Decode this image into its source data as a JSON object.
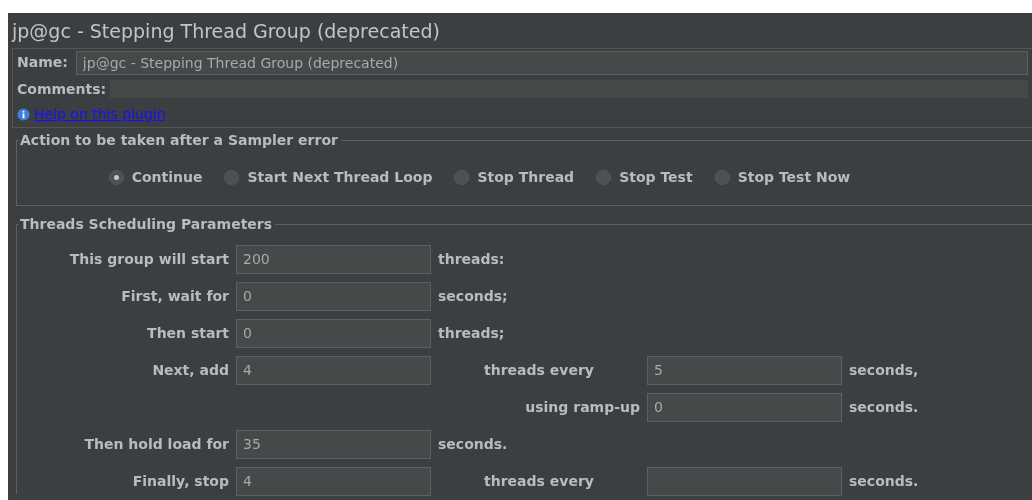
{
  "window": {
    "title": "jp@gc - Stepping Thread Group (deprecated)"
  },
  "name_field": {
    "label": "Name:",
    "value": "jp@gc - Stepping Thread Group (deprecated)"
  },
  "comments_field": {
    "label": "Comments:"
  },
  "help_link": "Help on this plugin",
  "sampler_error": {
    "title": "Action to be taken after a Sampler error",
    "options": [
      {
        "label": "Continue",
        "selected": true
      },
      {
        "label": "Start Next Thread Loop",
        "selected": false
      },
      {
        "label": "Stop Thread",
        "selected": false
      },
      {
        "label": "Stop Test",
        "selected": false
      },
      {
        "label": "Stop Test Now",
        "selected": false
      }
    ]
  },
  "scheduling": {
    "title": "Threads Scheduling Parameters",
    "rows": [
      {
        "label": "This group will start",
        "value": "200",
        "suffix": "threads:"
      },
      {
        "label": "First, wait for",
        "value": "0",
        "suffix": "seconds;"
      },
      {
        "label": "Then start",
        "value": "0",
        "suffix": "threads;"
      },
      {
        "label": "Next, add",
        "value": "4",
        "second_label": "threads every",
        "second_value": "5",
        "second_suffix": "seconds,"
      },
      {
        "second_label": "using ramp-up",
        "second_value": "0",
        "second_suffix": "seconds."
      },
      {
        "label": "Then hold load for",
        "value": "35",
        "suffix": "seconds."
      },
      {
        "label": "Finally, stop",
        "value": "4",
        "second_label": "threads every",
        "second_suffix": "seconds."
      }
    ]
  }
}
